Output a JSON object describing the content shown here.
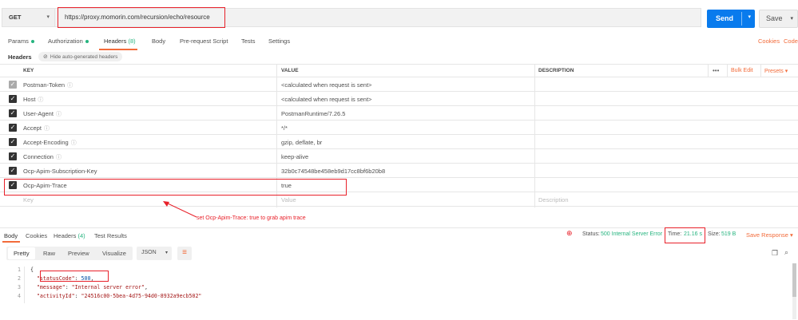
{
  "request": {
    "method": "GET",
    "url": "https://proxy.momorin.com/recursion/echo/resource",
    "send_label": "Send",
    "save_label": "Save"
  },
  "request_tabs": [
    {
      "label": "Params",
      "dot": true
    },
    {
      "label": "Authorization",
      "dot": true
    },
    {
      "label": "Headers",
      "count": "(8)",
      "active": true
    },
    {
      "label": "Body"
    },
    {
      "label": "Pre-request Script"
    },
    {
      "label": "Tests"
    },
    {
      "label": "Settings"
    }
  ],
  "links": {
    "cookies": "Cookies",
    "code": "Code"
  },
  "headers_section": {
    "label": "Headers",
    "hide_auto": "Hide auto-generated headers"
  },
  "table": {
    "columns": {
      "key": "KEY",
      "value": "VALUE",
      "description": "DESCRIPTION"
    },
    "more": "•••",
    "bulk_edit": "Bulk Edit",
    "presets": "Presets",
    "rows": [
      {
        "key": "Postman-Token",
        "info": true,
        "value": "<calculated when request is sent>",
        "checked": true,
        "grey": true
      },
      {
        "key": "Host",
        "info": true,
        "value": "<calculated when request is sent>",
        "checked": true
      },
      {
        "key": "User-Agent",
        "info": true,
        "value": "PostmanRuntime/7.26.5",
        "checked": true
      },
      {
        "key": "Accept",
        "info": true,
        "value": "*/*",
        "checked": true
      },
      {
        "key": "Accept-Encoding",
        "info": true,
        "value": "gzip, deflate, br",
        "checked": true
      },
      {
        "key": "Connection",
        "info": true,
        "value": "keep-alive",
        "checked": true
      },
      {
        "key": "Ocp-Apim-Subscription-Key",
        "info": false,
        "value": "32b0c74548be458eb9d17cc8bf6b20b8",
        "checked": true
      },
      {
        "key": "Ocp-Apim-Trace",
        "info": false,
        "value": "true",
        "checked": true
      }
    ],
    "placeholder": {
      "key": "Key",
      "value": "Value",
      "description": "Description"
    }
  },
  "annotation": "set Ocp-Apim-Trace: true to grab apim trace",
  "response_tabs": [
    {
      "label": "Body",
      "active": true
    },
    {
      "label": "Cookies"
    },
    {
      "label": "Headers",
      "count": "(4)"
    },
    {
      "label": "Test Results"
    }
  ],
  "response_meta": {
    "status_label": "Status:",
    "status_value": "500 Internal Server Error",
    "time_label": "Time:",
    "time_value": "21.16 s",
    "size_label": "Size:",
    "size_value": "519 B",
    "save_response": "Save Response"
  },
  "view_buttons": [
    "Pretty",
    "Raw",
    "Preview",
    "Visualize"
  ],
  "format": "JSON",
  "code_lines": [
    {
      "n": "1",
      "text": "{"
    },
    {
      "n": "2",
      "key": "\"statusCode\"",
      "sep": ": ",
      "val": "500",
      "end": ","
    },
    {
      "n": "3",
      "key": "\"message\"",
      "sep": ": ",
      "str": "\"Internal server error\"",
      "end": ","
    },
    {
      "n": "4",
      "key": "\"activityId\"",
      "sep": ": ",
      "str": "\"24516c00-5bea-4d75-94d0-8932a9ecb502\"",
      "end": ""
    }
  ],
  "colors": {
    "accent": "#f26b3a",
    "send": "#097bed",
    "success": "#26b47f",
    "annotation": "#e8212a"
  }
}
